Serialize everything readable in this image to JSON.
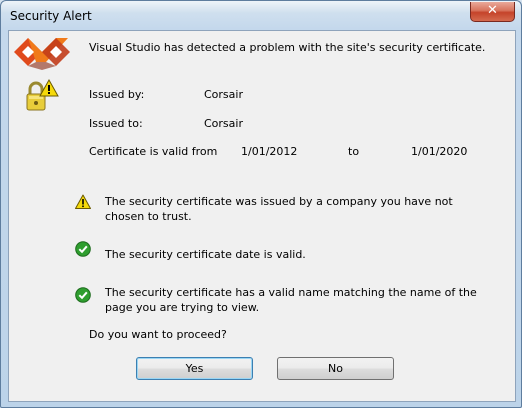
{
  "window": {
    "title": "Security Alert",
    "close_glyph": "✕"
  },
  "header": {
    "message": "Visual Studio has detected a problem with the site's security certificate."
  },
  "certificate": {
    "issued_by_label": "Issued by:",
    "issued_by_value": "Corsair",
    "issued_to_label": "Issued to:",
    "issued_to_value": "Corsair",
    "validity_label": "Certificate is valid from",
    "valid_from": "1/01/2012",
    "to_label": "to",
    "valid_to": "1/01/2020"
  },
  "checks": [
    {
      "status": "warning",
      "text": "The security certificate was issued by a company you have not chosen to trust."
    },
    {
      "status": "ok",
      "text": "The security certificate date is valid."
    },
    {
      "status": "ok",
      "text": "The security certificate has a valid name matching the name of the page you are trying to view."
    }
  ],
  "prompt": "Do you want to proceed?",
  "buttons": {
    "yes_label": "Yes",
    "no_label": "No"
  },
  "icons": {
    "app": "visual-studio-logo-icon",
    "lock": "padlock-warning-icon",
    "warning": "warning-triangle-icon",
    "ok": "check-circle-icon"
  },
  "colors": {
    "warning_yellow": "#f5d90a",
    "ok_green": "#2f9e2f",
    "default_button_border": "#3c7fb1"
  }
}
